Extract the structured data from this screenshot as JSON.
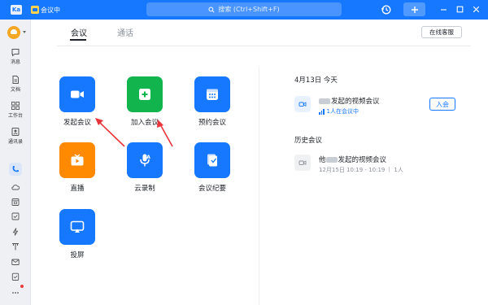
{
  "titlebar": {
    "logo_text": "Ka",
    "meeting_label": "会议中",
    "search_placeholder": "搜索 (Ctrl+Shift+F)",
    "icons": [
      "history-icon",
      "plus-icon",
      "minimize-icon",
      "maximize-icon",
      "close-icon"
    ]
  },
  "sidebar": {
    "items": [
      {
        "label": "消息",
        "icon": "chat-icon"
      },
      {
        "label": "文档",
        "icon": "document-icon"
      },
      {
        "label": "工作台",
        "icon": "apps-icon"
      },
      {
        "label": "通讯录",
        "icon": "contacts-icon"
      }
    ],
    "extra_icons": [
      "phone-icon",
      "cloud-icon",
      "calendar-icon",
      "task-icon",
      "lightning-icon",
      "tools-icon",
      "mail-icon",
      "clipboard-icon",
      "more-icon"
    ],
    "active_icon": "phone-icon"
  },
  "tabs": [
    {
      "label": "会议",
      "active": true
    },
    {
      "label": "通话",
      "active": false
    }
  ],
  "support_button": "在线客服",
  "tiles": [
    {
      "label": "发起会议",
      "icon": "video-camera-icon",
      "color": "#1677ff"
    },
    {
      "label": "加入会议",
      "icon": "plus-square-icon",
      "color": "#12b44e"
    },
    {
      "label": "预约会议",
      "icon": "calendar-grid-icon",
      "color": "#1677ff"
    },
    {
      "label": "直播",
      "icon": "tv-play-icon",
      "color": "#ff8a00"
    },
    {
      "label": "云录制",
      "icon": "microphone-icon",
      "color": "#1677ff"
    },
    {
      "label": "会议纪要",
      "icon": "notes-icon",
      "color": "#1677ff"
    },
    {
      "label": "投屏",
      "icon": "cast-screen-icon",
      "color": "#1677ff"
    }
  ],
  "today": {
    "heading": "4月13日 今天",
    "meeting": {
      "title": "发起的视频会议",
      "status": "1人在会议中",
      "join_label": "入会"
    }
  },
  "history": {
    "heading": "历史会议",
    "meeting": {
      "title_prefix": "他",
      "title": "发起的视频会议",
      "time": "12月15日 10:19 - 10:19",
      "attendees": "1人"
    }
  }
}
